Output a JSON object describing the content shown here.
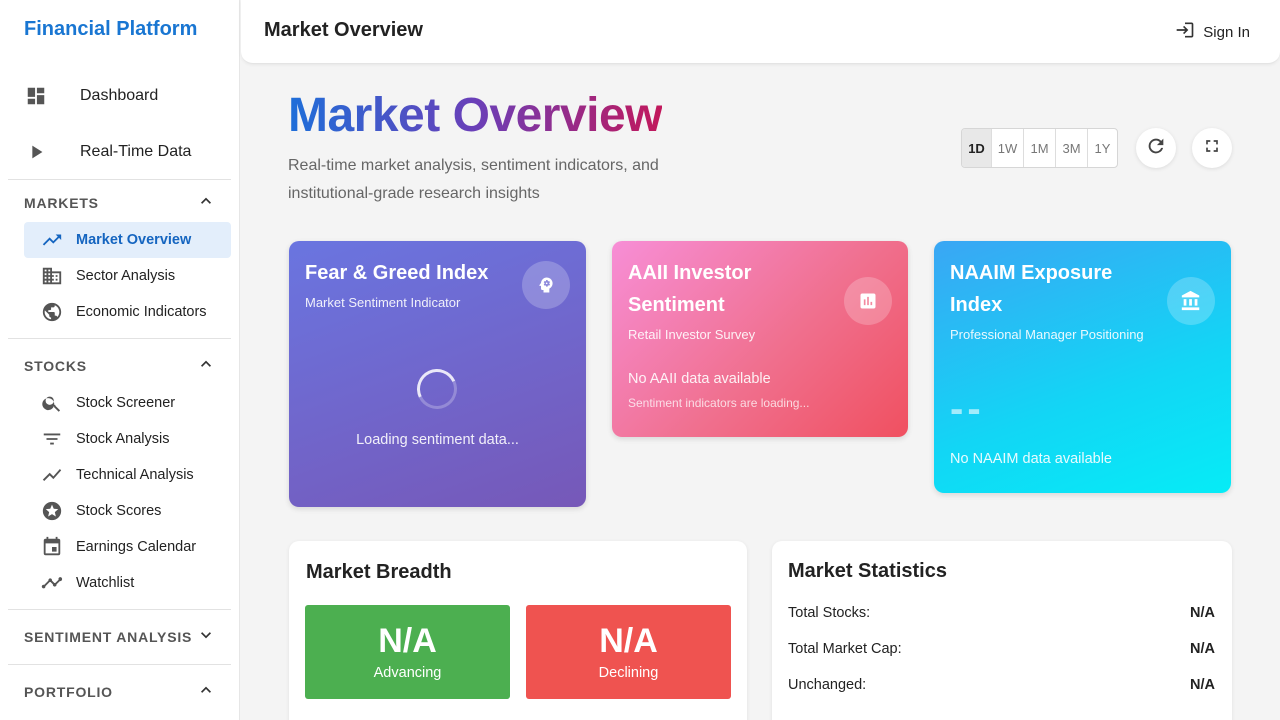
{
  "brand": "Financial Platform",
  "nav": {
    "dashboard": "Dashboard",
    "realtime": "Real-Time Data"
  },
  "sections": {
    "markets": "MARKETS",
    "stocks": "STOCKS",
    "sentiment": "SENTIMENT ANALYSIS",
    "portfolio": "PORTFOLIO"
  },
  "markets_items": [
    "Market Overview",
    "Sector Analysis",
    "Economic Indicators"
  ],
  "stocks_items": [
    "Stock Screener",
    "Stock Analysis",
    "Technical Analysis",
    "Stock Scores",
    "Earnings Calendar",
    "Watchlist"
  ],
  "topbar": {
    "title": "Market Overview",
    "signin": "Sign In"
  },
  "hero": {
    "title": "Market Overview",
    "subtitle": "Real-time market analysis, sentiment indicators, and institutional-grade research insights"
  },
  "ranges": [
    "1D",
    "1W",
    "1M",
    "3M",
    "1Y"
  ],
  "selected_range": "1D",
  "cards": {
    "fear_greed": {
      "title": "Fear & Greed Index",
      "subtitle": "Market Sentiment Indicator",
      "loading": "Loading sentiment data..."
    },
    "aaii": {
      "title": "AAII Investor Sentiment",
      "subtitle": "Retail Investor Survey",
      "empty": "No AAII data available",
      "note": "Sentiment indicators are loading..."
    },
    "naaim": {
      "title": "NAAIM Exposure Index",
      "subtitle": "Professional Manager Positioning",
      "value": "--",
      "empty": "No NAAIM data available"
    }
  },
  "breadth": {
    "title": "Market Breadth",
    "advancing_value": "N/A",
    "advancing_label": "Advancing",
    "declining_value": "N/A",
    "declining_label": "Declining"
  },
  "stats": {
    "title": "Market Statistics",
    "rows": [
      {
        "label": "Total Stocks:",
        "value": "N/A"
      },
      {
        "label": "Total Market Cap:",
        "value": "N/A"
      },
      {
        "label": "Unchanged:",
        "value": "N/A"
      }
    ]
  },
  "colors": {
    "brand": "#1976d2",
    "advancing": "#4caf50",
    "declining": "#ef5350"
  }
}
